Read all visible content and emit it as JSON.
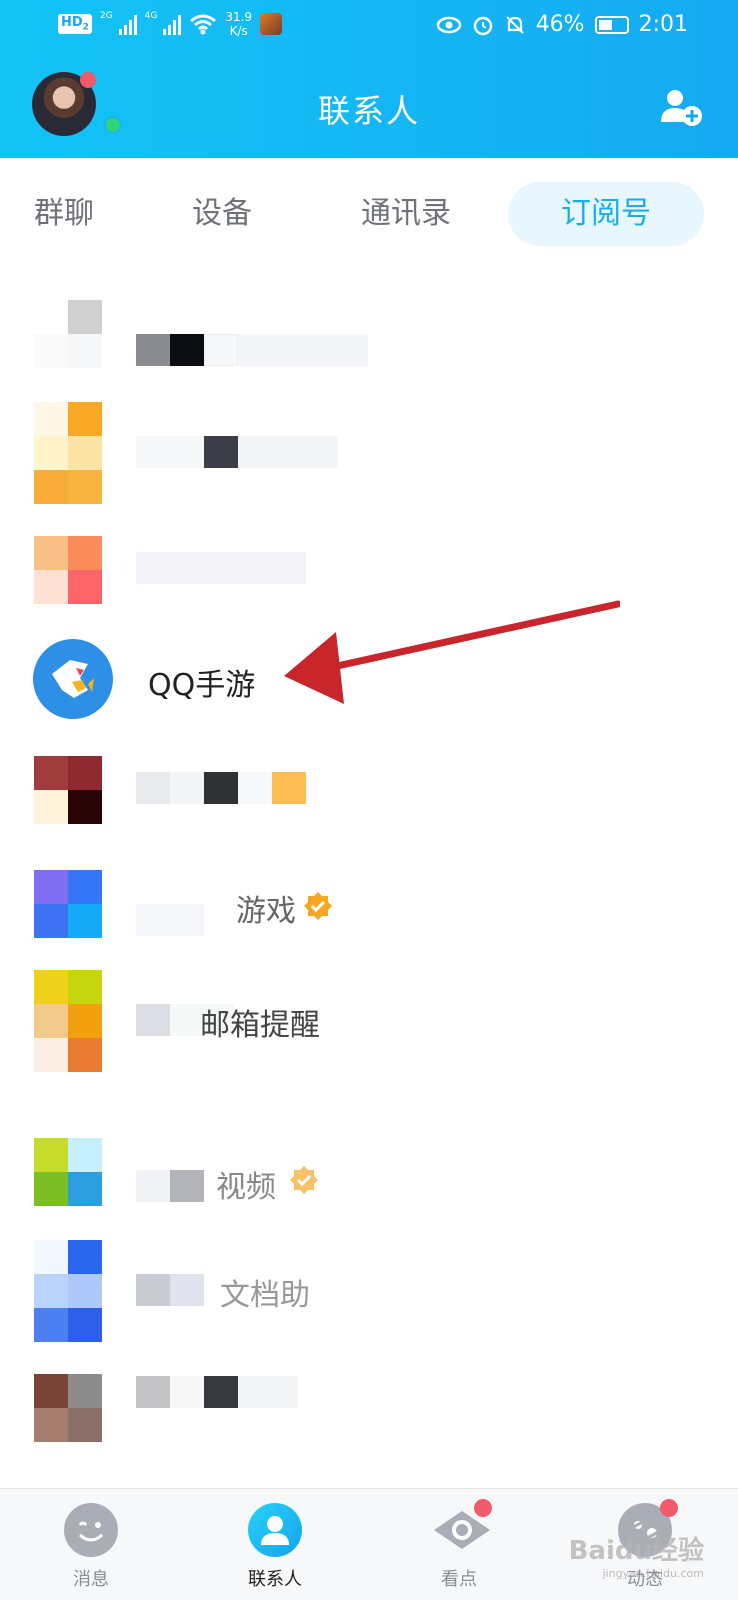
{
  "status_bar": {
    "hd_badge": "HD",
    "hd_sub": "2",
    "sig1_label": "2G",
    "sig2_label": "4G",
    "speed_value": "31.9",
    "speed_unit": "K/s",
    "battery_text": "46%",
    "time": "2:01",
    "icons": [
      "eye-icon",
      "alarm-icon",
      "mute-icon",
      "battery-icon"
    ]
  },
  "header": {
    "title": "联系人",
    "accent_color": "#15aaf2"
  },
  "tabs": [
    {
      "label": "群聊",
      "active": false
    },
    {
      "label": "设备",
      "active": false
    },
    {
      "label": "通讯录",
      "active": false
    },
    {
      "label": "订阅号",
      "active": true
    }
  ],
  "list": {
    "highlighted": {
      "name": "QQ手游",
      "icon": "qq-mobile-game-icon"
    },
    "partial_names": {
      "row6": "游戏",
      "row7": "邮箱提醒",
      "row8": "视频",
      "row9": "文档助"
    }
  },
  "annotation": {
    "arrow_color": "#c8262b"
  },
  "bottom_nav": [
    {
      "label": "消息",
      "icon": "message-icon",
      "active": false,
      "badge": false
    },
    {
      "label": "联系人",
      "icon": "contacts-icon",
      "active": true,
      "badge": false
    },
    {
      "label": "看点",
      "icon": "eye-icon",
      "active": false,
      "badge": true
    },
    {
      "label": "动态",
      "icon": "planet-icon",
      "active": false,
      "badge": true
    }
  ],
  "watermark": {
    "text": "Baidu经验",
    "sub": "jingyan.baidu.com"
  }
}
